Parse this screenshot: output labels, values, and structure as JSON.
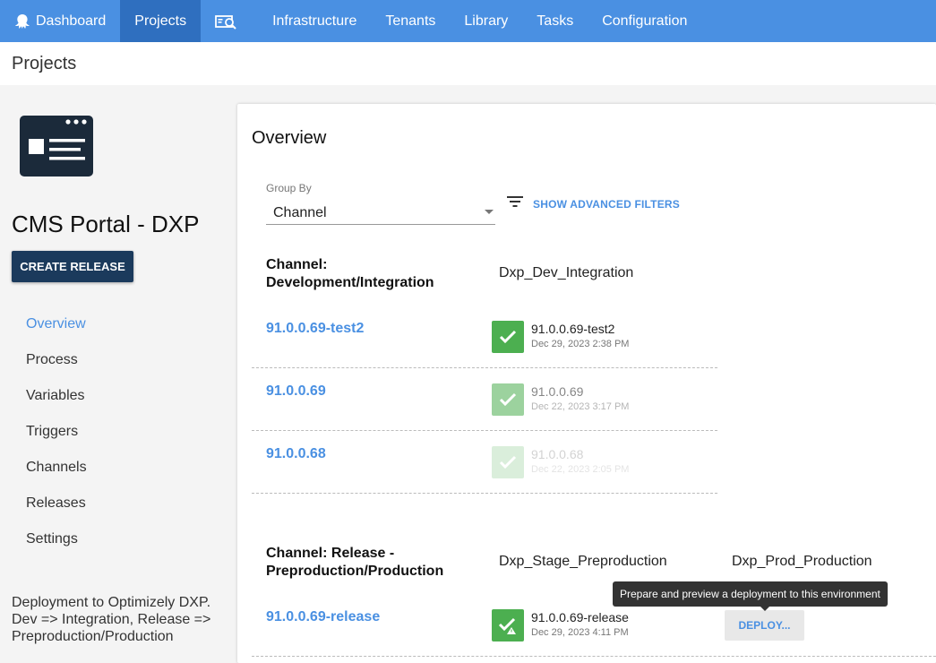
{
  "nav": {
    "items": [
      {
        "label": "Dashboard",
        "icon": "octopus-icon"
      },
      {
        "label": "Projects",
        "active": true
      },
      {
        "label": "",
        "icon": "search-resource-icon"
      },
      {
        "label": "Infrastructure"
      },
      {
        "label": "Tenants"
      },
      {
        "label": "Library"
      },
      {
        "label": "Tasks"
      },
      {
        "label": "Configuration"
      }
    ]
  },
  "page": {
    "title": "Projects"
  },
  "project": {
    "name": "CMS Portal - DXP",
    "create_release_label": "CREATE RELEASE",
    "description": "Deployment to Optimizely DXP. Dev => Integration, Release => Preproduction/Production"
  },
  "sidebar": {
    "items": [
      {
        "label": "Overview",
        "active": true
      },
      {
        "label": "Process"
      },
      {
        "label": "Variables"
      },
      {
        "label": "Triggers"
      },
      {
        "label": "Channels"
      },
      {
        "label": "Releases"
      },
      {
        "label": "Settings"
      }
    ]
  },
  "overview": {
    "title": "Overview",
    "group_by": {
      "label": "Group By",
      "value": "Channel"
    },
    "advanced_filters_label": "SHOW ADVANCED FILTERS",
    "channels": [
      {
        "title": "Channel: Development/Integration",
        "environments": [
          "Dxp_Dev_Integration"
        ],
        "releases": [
          {
            "version": "91.0.0.69-test2",
            "deployments": [
              {
                "version": "91.0.0.69-test2",
                "date": "Dec 29, 2023 2:38 PM",
                "status": "success"
              }
            ]
          },
          {
            "version": "91.0.0.69",
            "deployments": [
              {
                "version": "91.0.0.69",
                "date": "Dec 22, 2023 3:17 PM",
                "status": "success-previous"
              }
            ]
          },
          {
            "version": "91.0.0.68",
            "deployments": [
              {
                "version": "91.0.0.68",
                "date": "Dec 22, 2023 2:05 PM",
                "status": "success-old"
              }
            ]
          }
        ]
      },
      {
        "title": "Channel: Release - Preproduction/Production",
        "environments": [
          "Dxp_Stage_Preproduction",
          "Dxp_Prod_Production"
        ],
        "releases": [
          {
            "version": "91.0.0.69-release",
            "deployments": [
              {
                "version": "91.0.0.69-release",
                "date": "Dec 29, 2023 4:11 PM",
                "status": "success-warning"
              }
            ],
            "deploy_label": "DEPLOY..."
          }
        ]
      }
    ],
    "tooltip": "Prepare and preview a deployment to this environment"
  },
  "colors": {
    "nav": "#4a90e2",
    "nav_active": "#2f6fbf",
    "success": "#4caf50",
    "accent": "#4a90e2",
    "button_dark": "#1b3a5c"
  }
}
